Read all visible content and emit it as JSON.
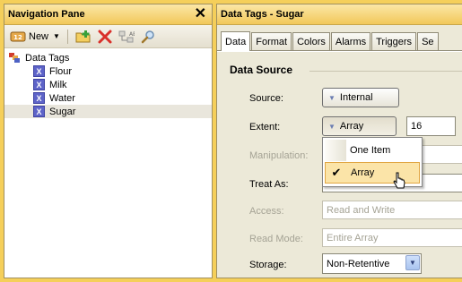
{
  "nav": {
    "title": "Navigation Pane",
    "toolbar": {
      "new_label": "New"
    },
    "root_label": "Data Tags",
    "tag_icon_letter": "X",
    "items": [
      {
        "label": "Flour"
      },
      {
        "label": "Milk"
      },
      {
        "label": "Water"
      },
      {
        "label": "Sugar",
        "selected": true
      }
    ]
  },
  "right": {
    "title": "Data Tags - Sugar",
    "tabs": [
      "Data",
      "Format",
      "Colors",
      "Alarms",
      "Triggers",
      "Se"
    ],
    "active_tab": "Data",
    "section_title": "Data Source",
    "fields": {
      "source": {
        "label": "Source:",
        "value": "Internal"
      },
      "extent": {
        "label": "Extent:",
        "value": "Array",
        "count": "16"
      },
      "manipulation": {
        "label": "Manipulation:"
      },
      "treat_as": {
        "label": "Treat As:"
      },
      "access": {
        "label": "Access:",
        "value": "Read and Write"
      },
      "read_mode": {
        "label": "Read Mode:",
        "value": "Entire Array"
      },
      "storage": {
        "label": "Storage:",
        "value": "Non-Retentive"
      }
    },
    "dropdown_options": [
      {
        "label": "One Item",
        "checked": false
      },
      {
        "label": "Array",
        "checked": true
      }
    ]
  },
  "colors": {
    "frame": "#f5cf5a",
    "header": "#f2c85a",
    "tag_icon": "#5d63c8",
    "menu_highlight": "#fbe4a8"
  },
  "icons": [
    "close-icon",
    "new-tag-icon",
    "add-folder-icon",
    "delete-icon",
    "tag-sort-icon",
    "search-icon",
    "checkmark-icon",
    "mouse-cursor-icon"
  ]
}
